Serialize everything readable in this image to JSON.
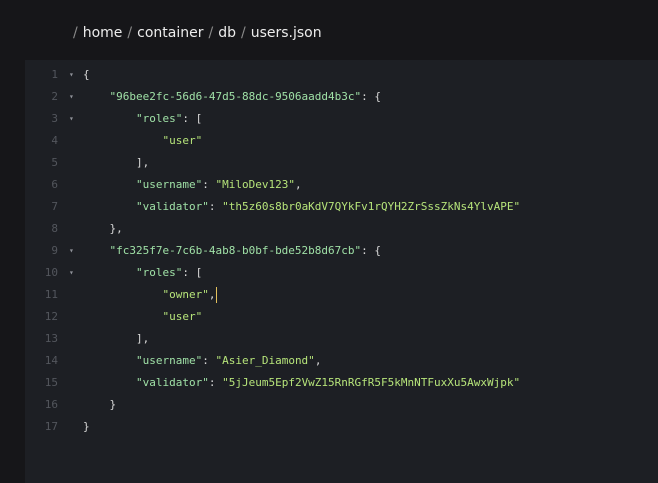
{
  "breadcrumb": {
    "separator": "/",
    "segments": [
      "home",
      "container",
      "db",
      "users.json"
    ]
  },
  "editor": {
    "fold_icon": "triangle-down",
    "lines": [
      {
        "n": "1",
        "fold": true,
        "t": [
          [
            "p",
            "{"
          ]
        ]
      },
      {
        "n": "2",
        "fold": true,
        "t": [
          [
            "ws",
            "    "
          ],
          [
            "k",
            "\"96bee2fc-56d6-47d5-88dc-9506aadd4b3c\""
          ],
          [
            "p",
            ": {"
          ]
        ]
      },
      {
        "n": "3",
        "fold": true,
        "t": [
          [
            "ws",
            "        "
          ],
          [
            "k",
            "\"roles\""
          ],
          [
            "p",
            ": ["
          ]
        ]
      },
      {
        "n": "4",
        "fold": false,
        "t": [
          [
            "ws",
            "            "
          ],
          [
            "s",
            "\"user\""
          ]
        ]
      },
      {
        "n": "5",
        "fold": false,
        "t": [
          [
            "ws",
            "        "
          ],
          [
            "p",
            "],"
          ]
        ]
      },
      {
        "n": "6",
        "fold": false,
        "t": [
          [
            "ws",
            "        "
          ],
          [
            "k",
            "\"username\""
          ],
          [
            "p",
            ": "
          ],
          [
            "s",
            "\"MiloDev123\""
          ],
          [
            "p",
            ","
          ]
        ]
      },
      {
        "n": "7",
        "fold": false,
        "t": [
          [
            "ws",
            "        "
          ],
          [
            "k",
            "\"validator\""
          ],
          [
            "p",
            ": "
          ],
          [
            "s",
            "\"th5z60s8br0aKdV7QYkFv1rQYH2ZrSssZkNs4YlvAPE\""
          ]
        ]
      },
      {
        "n": "8",
        "fold": false,
        "t": [
          [
            "ws",
            "    "
          ],
          [
            "p",
            "},"
          ]
        ]
      },
      {
        "n": "9",
        "fold": true,
        "t": [
          [
            "ws",
            "    "
          ],
          [
            "k",
            "\"fc325f7e-7c6b-4ab8-b0bf-bde52b8d67cb\""
          ],
          [
            "p",
            ": {"
          ]
        ]
      },
      {
        "n": "10",
        "fold": true,
        "t": [
          [
            "ws",
            "        "
          ],
          [
            "k",
            "\"roles\""
          ],
          [
            "p",
            ": ["
          ]
        ]
      },
      {
        "n": "11",
        "fold": false,
        "caret": true,
        "t": [
          [
            "ws",
            "            "
          ],
          [
            "s",
            "\"owner\""
          ],
          [
            "p",
            ","
          ]
        ]
      },
      {
        "n": "12",
        "fold": false,
        "t": [
          [
            "ws",
            "            "
          ],
          [
            "s",
            "\"user\""
          ]
        ]
      },
      {
        "n": "13",
        "fold": false,
        "t": [
          [
            "ws",
            "        "
          ],
          [
            "p",
            "],"
          ]
        ]
      },
      {
        "n": "14",
        "fold": false,
        "t": [
          [
            "ws",
            "        "
          ],
          [
            "k",
            "\"username\""
          ],
          [
            "p",
            ": "
          ],
          [
            "s",
            "\"Asier_Diamond\""
          ],
          [
            "p",
            ","
          ]
        ]
      },
      {
        "n": "15",
        "fold": false,
        "t": [
          [
            "ws",
            "        "
          ],
          [
            "k",
            "\"validator\""
          ],
          [
            "p",
            ": "
          ],
          [
            "s",
            "\"5jJeum5Epf2VwZ15RnRGfR5F5kMnNTFuxXu5AwxWjpk\""
          ]
        ]
      },
      {
        "n": "16",
        "fold": false,
        "t": [
          [
            "ws",
            "    "
          ],
          [
            "p",
            "}"
          ]
        ]
      },
      {
        "n": "17",
        "fold": false,
        "t": [
          [
            "p",
            "}"
          ]
        ]
      }
    ]
  }
}
